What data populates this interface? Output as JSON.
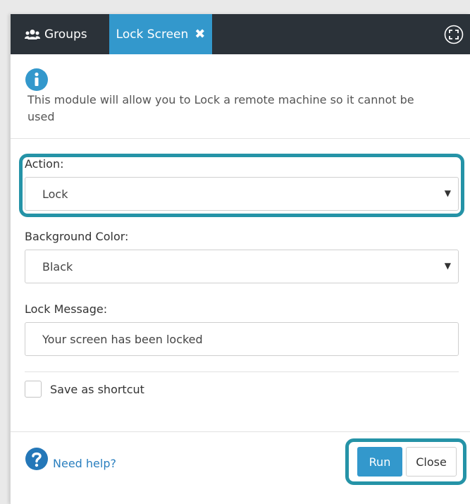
{
  "tabs": {
    "groups_label": "Groups",
    "lock_label": "Lock Screen",
    "lock_close_glyph": "✖"
  },
  "info": {
    "text": "This module will allow you to Lock a remote machine so it cannot be used"
  },
  "form": {
    "action_label": "Action:",
    "action_value": "Lock",
    "bg_label": "Background Color:",
    "bg_value": "Black",
    "message_label": "Lock Message:",
    "message_value": "Your screen has been locked",
    "shortcut_label": "Save as shortcut",
    "shortcut_checked": false
  },
  "footer": {
    "help_label": "Need help?",
    "run_label": "Run",
    "close_label": "Close"
  },
  "icons": {
    "groups": "users-icon",
    "expand": "expand-icon",
    "info": "info-icon",
    "help": "question-icon",
    "dropdown": "caret-down-icon"
  },
  "colors": {
    "topbar": "#2b3239",
    "accent": "#3398cc",
    "highlight": "#2593a7",
    "link": "#2a7fbf"
  }
}
